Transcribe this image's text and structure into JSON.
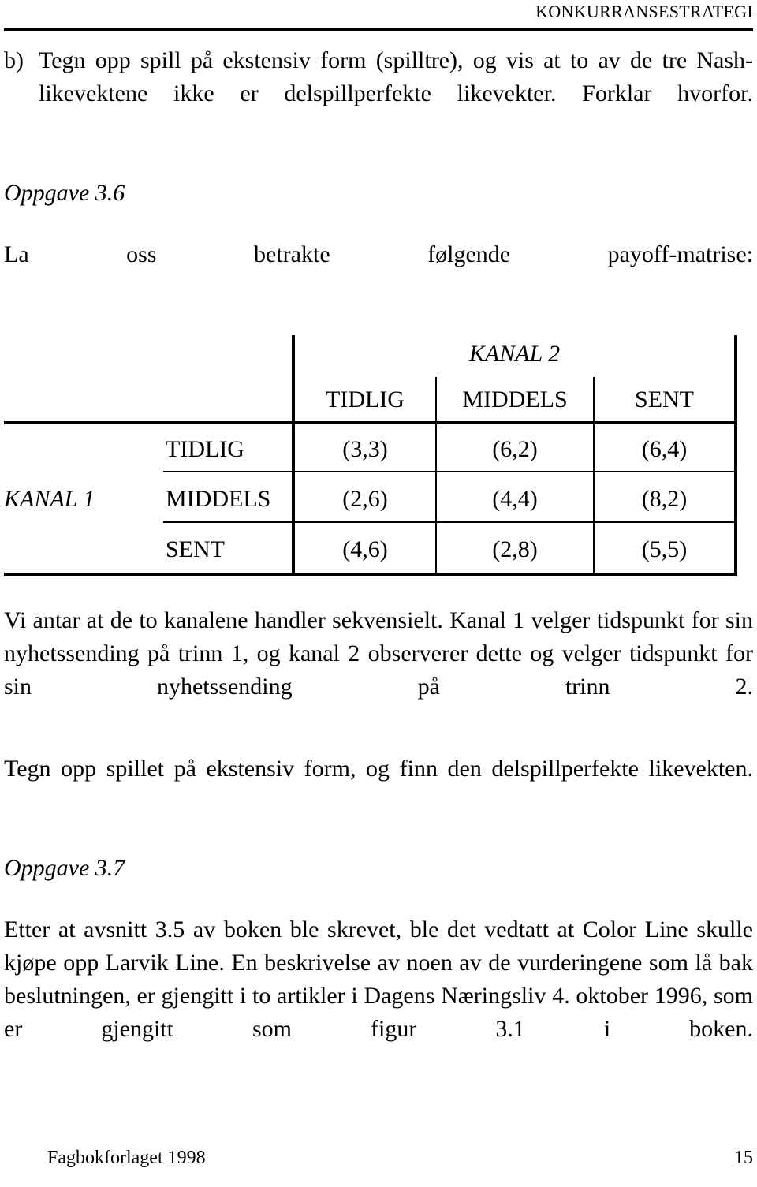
{
  "header": {
    "running_title": "KONKURRANSESTRATEGI"
  },
  "question_b": {
    "marker": "b)",
    "text": "Tegn opp spill på ekstensiv form (spilltre), og vis at to av de tre Nash-likevektene ikke er delspillperfekte likevekter. Forklar hvorfor."
  },
  "task_36": {
    "heading": "Oppgave 3.6",
    "intro": "La oss betrakte følgende payoff-matrise:",
    "paragraph_1": "Vi antar at de to kanalene handler sekvensielt. Kanal 1 velger tidspunkt for sin nyhetssending på trinn 1, og kanal 2 observerer dette og velger tidspunkt for sin nyhetssending på trinn 2.",
    "paragraph_2": "Tegn opp spillet på ekstensiv form, og finn den delspillperfekte likevekten."
  },
  "payoff_matrix": {
    "column_player": "KANAL 2",
    "row_player": "KANAL 1",
    "column_headers": [
      "TIDLIG",
      "MIDDELS",
      "SENT"
    ],
    "row_headers": [
      "TIDLIG",
      "MIDDELS",
      "SENT"
    ],
    "cells": [
      [
        "(3,3)",
        "(6,2)",
        "(6,4)"
      ],
      [
        "(2,6)",
        "(4,4)",
        "(8,2)"
      ],
      [
        "(4,6)",
        "(2,8)",
        "(5,5)"
      ]
    ]
  },
  "task_37": {
    "heading": "Oppgave 3.7",
    "paragraph_1": "Etter at avsnitt 3.5 av boken ble skrevet, ble det vedtatt at Color Line skulle kjøpe opp Larvik Line. En beskrivelse av noen av de vurderingene som lå bak beslutningen, er gjengitt i to artikler i Dagens Næringsliv 4. oktober 1996, som er gjengitt som figur 3.1 i boken."
  },
  "footer": {
    "publisher": "Fagbokforlaget 1998",
    "page_number": "15"
  }
}
